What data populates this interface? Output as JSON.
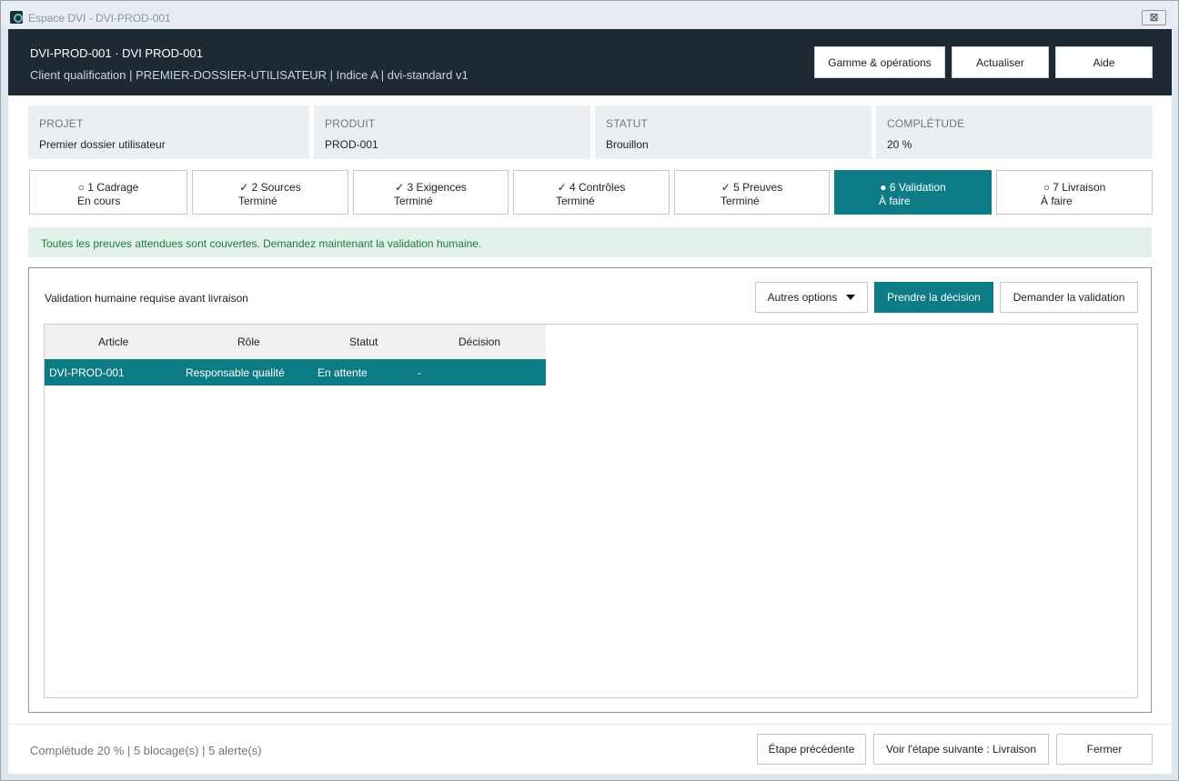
{
  "window": {
    "title": "Espace DVI - DVI-PROD-001",
    "close_glyph": "⊠"
  },
  "header": {
    "title": "DVI-PROD-001  ·  DVI PROD-001",
    "subtitle": "Client qualification  |  PREMIER-DOSSIER-UTILISATEUR  |  Indice A  |  dvi-standard v1",
    "buttons": {
      "gamme": "Gamme & opérations",
      "refresh": "Actualiser",
      "help": "Aide"
    }
  },
  "info": {
    "projet": {
      "label": "PROJET",
      "value": "Premier dossier utilisateur"
    },
    "produit": {
      "label": "PRODUIT",
      "value": "PROD-001"
    },
    "statut": {
      "label": "STATUT",
      "value": "Brouillon"
    },
    "completude": {
      "label": "COMPLÉTUDE",
      "value": "20 %"
    }
  },
  "steps": [
    {
      "line1": "○ 1  Cadrage",
      "line2": "En cours",
      "state": "current"
    },
    {
      "line1": "✓ 2  Sources",
      "line2": "Terminé",
      "state": "done"
    },
    {
      "line1": "✓ 3  Exigences",
      "line2": "Terminé",
      "state": "done"
    },
    {
      "line1": "✓ 4  Contrôles",
      "line2": "Terminé",
      "state": "done"
    },
    {
      "line1": "✓ 5  Preuves",
      "line2": "Terminé",
      "state": "done"
    },
    {
      "line1": "● 6  Validation",
      "line2": "À faire",
      "state": "active"
    },
    {
      "line1": "○ 7  Livraison",
      "line2": "À faire",
      "state": "todo"
    }
  ],
  "banner": {
    "text": "Toutes les preuves attendues sont couvertes. Demandez maintenant la validation humaine."
  },
  "validation": {
    "title": "Validation humaine requise avant livraison",
    "buttons": {
      "more": "Autres options",
      "decide": "Prendre la décision",
      "request": "Demander la validation"
    },
    "columns": [
      "Article",
      "Rôle",
      "Statut",
      "Décision"
    ],
    "rows": [
      [
        "DVI-PROD-001",
        "Responsable qualité",
        "En attente",
        "-"
      ]
    ]
  },
  "footer": {
    "status": "Complétude 20 %  |  5 blocage(s)  |  5 alerte(s)",
    "buttons": {
      "prev": "Étape précédente",
      "next": "Voir l'étape suivante : Livraison",
      "close": "Fermer"
    }
  },
  "colors": {
    "accent": "#0e7c86",
    "header_bg": "#1e2933",
    "banner_bg": "#e2f1e9",
    "banner_text": "#1f7a3c"
  }
}
